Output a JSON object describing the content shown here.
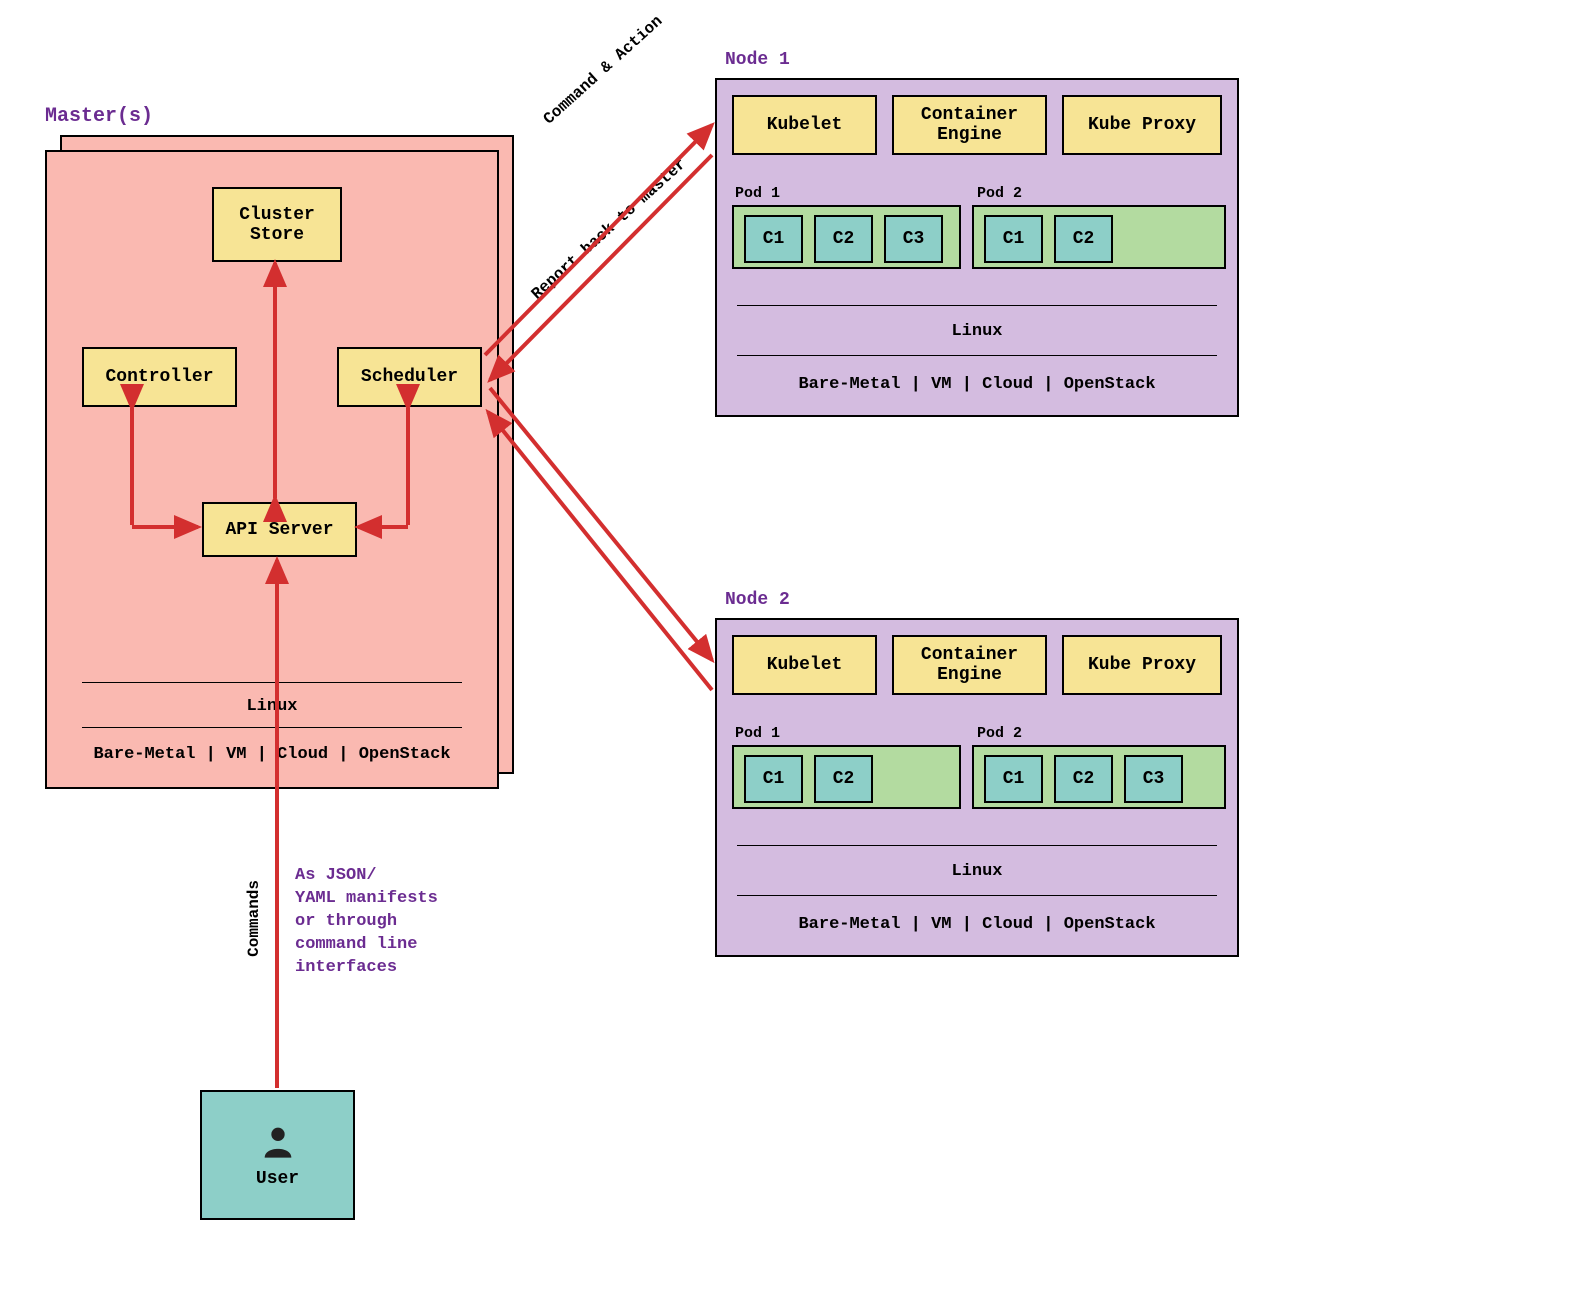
{
  "master": {
    "title": "Master(s)",
    "cluster_store": "Cluster\nStore",
    "controller": "Controller",
    "scheduler": "Scheduler",
    "api_server": "API Server",
    "os": "Linux",
    "infra": "Bare-Metal | VM | Cloud | OpenStack"
  },
  "node1": {
    "title": "Node 1",
    "kubelet": "Kubelet",
    "engine": "Container\nEngine",
    "proxy": "Kube Proxy",
    "pod1_label": "Pod 1",
    "pod2_label": "Pod 2",
    "pod1_containers": [
      "C1",
      "C2",
      "C3"
    ],
    "pod2_containers": [
      "C1",
      "C2"
    ],
    "os": "Linux",
    "infra": "Bare-Metal | VM | Cloud | OpenStack"
  },
  "node2": {
    "title": "Node 2",
    "kubelet": "Kubelet",
    "engine": "Container\nEngine",
    "proxy": "Kube Proxy",
    "pod1_label": "Pod 1",
    "pod2_label": "Pod 2",
    "pod1_containers": [
      "C1",
      "C2"
    ],
    "pod2_containers": [
      "C1",
      "C2",
      "C3"
    ],
    "os": "Linux",
    "infra": "Bare-Metal | VM | Cloud | OpenStack"
  },
  "user": {
    "label": "User",
    "commands_label": "Commands",
    "note": "As JSON/\nYAML manifests\nor through\ncommand line\ninterfaces"
  },
  "arrows": {
    "command_action": "Command & Action",
    "report_back": "Report back to master"
  }
}
